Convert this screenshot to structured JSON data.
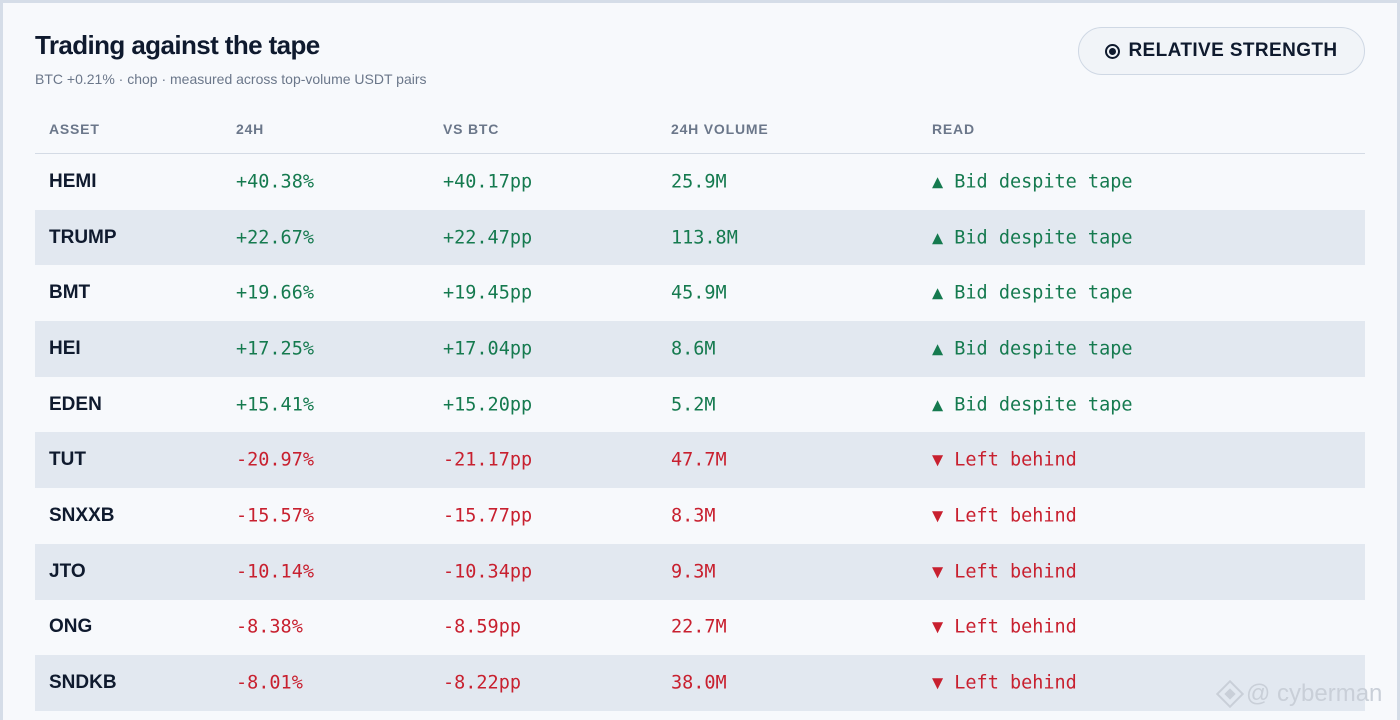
{
  "header": {
    "title": "Trading against the tape",
    "subtitle": "BTC +0.21% · chop · measured across top-volume USDT pairs",
    "badge_label": "RELATIVE STRENGTH"
  },
  "table": {
    "columns": [
      "ASSET",
      "24H",
      "VS BTC",
      "24H VOLUME",
      "READ"
    ],
    "rows": [
      {
        "asset": "HEMI",
        "change": "+40.38%",
        "vs_btc": "+40.17pp",
        "volume": "25.9M",
        "read": "▲ Bid despite tape",
        "direction": "up"
      },
      {
        "asset": "TRUMP",
        "change": "+22.67%",
        "vs_btc": "+22.47pp",
        "volume": "113.8M",
        "read": "▲ Bid despite tape",
        "direction": "up"
      },
      {
        "asset": "BMT",
        "change": "+19.66%",
        "vs_btc": "+19.45pp",
        "volume": "45.9M",
        "read": "▲ Bid despite tape",
        "direction": "up"
      },
      {
        "asset": "HEI",
        "change": "+17.25%",
        "vs_btc": "+17.04pp",
        "volume": "8.6M",
        "read": "▲ Bid despite tape",
        "direction": "up"
      },
      {
        "asset": "EDEN",
        "change": "+15.41%",
        "vs_btc": "+15.20pp",
        "volume": "5.2M",
        "read": "▲ Bid despite tape",
        "direction": "up"
      },
      {
        "asset": "TUT",
        "change": "-20.97%",
        "vs_btc": "-21.17pp",
        "volume": "47.7M",
        "read": "▼ Left behind",
        "direction": "down"
      },
      {
        "asset": "SNXXB",
        "change": "-15.57%",
        "vs_btc": "-15.77pp",
        "volume": "8.3M",
        "read": "▼ Left behind",
        "direction": "down"
      },
      {
        "asset": "JTO",
        "change": "-10.14%",
        "vs_btc": "-10.34pp",
        "volume": "9.3M",
        "read": "▼ Left behind",
        "direction": "down"
      },
      {
        "asset": "ONG",
        "change": "-8.38%",
        "vs_btc": "-8.59pp",
        "volume": "22.7M",
        "read": "▼ Left behind",
        "direction": "down"
      },
      {
        "asset": "SNDKB",
        "change": "-8.01%",
        "vs_btc": "-8.22pp",
        "volume": "38.0M",
        "read": "▼ Left behind",
        "direction": "down"
      }
    ]
  },
  "watermark": {
    "text": "@ cyberman",
    "icon": "binance-diamond-icon"
  },
  "colors": {
    "positive": "#157a4f",
    "negative": "#c8202f",
    "row_alt": "#e2e8f0"
  }
}
